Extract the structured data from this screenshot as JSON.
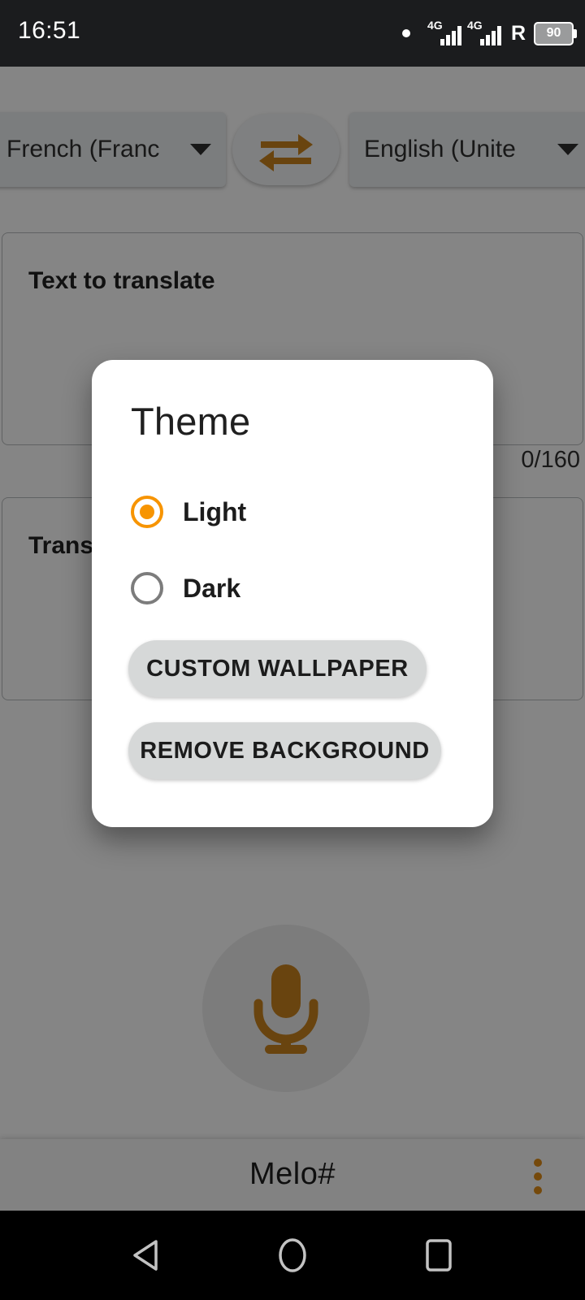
{
  "status_bar": {
    "clock": "16:51",
    "dot_icon": "dot-indicator-icon",
    "network_label_1": "4G",
    "network_label_2": "4G",
    "roaming_label": "R",
    "battery_level": "90"
  },
  "app": {
    "title": "Melo#",
    "overflow_icon": "overflow-menu-icon",
    "language": {
      "source_value": "French (Franc",
      "target_value": "English (Unite",
      "swap_icon": "swap-horizontal-icon",
      "dropdown_icon": "chevron-down-icon"
    },
    "source_field": {
      "label": "Text to translate",
      "counter": "0/160"
    },
    "target_field": {
      "label": "Trans"
    },
    "mic": {
      "icon": "microphone-icon"
    }
  },
  "dialog": {
    "title": "Theme",
    "options": [
      {
        "label": "Light",
        "selected": true
      },
      {
        "label": "Dark",
        "selected": false
      }
    ],
    "buttons": [
      {
        "label": "CUSTOM WALLPAPER"
      },
      {
        "label": "REMOVE BACKGROUND"
      }
    ]
  },
  "nav_bar": {
    "back_icon": "triangle-back-icon",
    "home_icon": "circle-home-icon",
    "recents_icon": "square-recents-icon"
  },
  "colors": {
    "accent_orange": "#f79400",
    "status_bar_bg": "#1b1c1e",
    "dialog_bg": "#ffffff",
    "button_grey": "#d6d8d8",
    "nav_bar_bg": "#000000"
  }
}
